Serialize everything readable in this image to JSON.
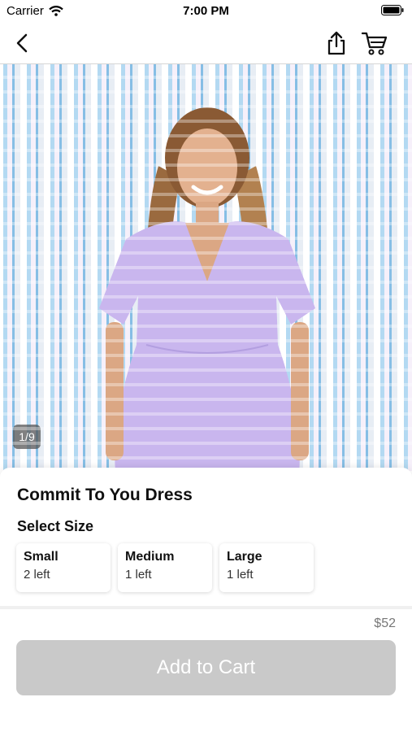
{
  "status_bar": {
    "carrier": "Carrier",
    "time": "7:00 PM",
    "icons": [
      "wifi-icon",
      "battery-icon"
    ]
  },
  "nav": {
    "icons": {
      "back": "chevron-left-icon",
      "share": "share-icon",
      "cart": "shopping-cart-icon"
    }
  },
  "gallery": {
    "counter": "1/9"
  },
  "product": {
    "title": "Commit To You Dress",
    "size_heading": "Select Size",
    "sizes": [
      {
        "name": "Small",
        "stock": "2 left"
      },
      {
        "name": "Medium",
        "stock": "1 left"
      },
      {
        "name": "Large",
        "stock": "1 left"
      }
    ],
    "price": "$52",
    "add_to_cart": "Add to Cart"
  },
  "colors": {
    "dress": "#c9b6ee",
    "button_disabled": "#c9c9c9",
    "price_text": "#777777"
  }
}
